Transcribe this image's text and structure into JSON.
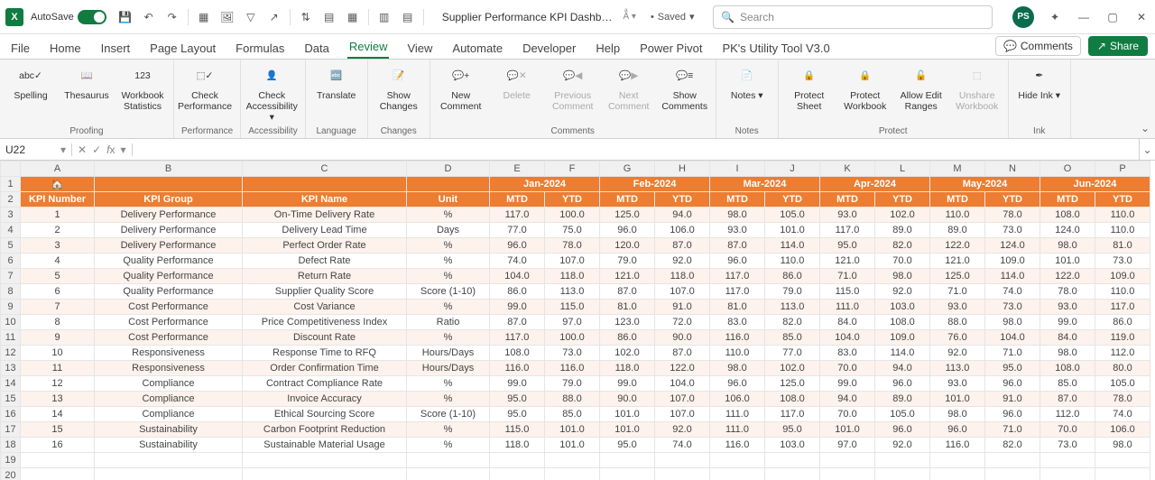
{
  "titlebar": {
    "autosave_label": "AutoSave",
    "doc_title": "Supplier Performance KPI Dashb…",
    "saved_label": "Saved",
    "search_placeholder": "Search",
    "avatar_initials": "PS"
  },
  "tabs": [
    "File",
    "Home",
    "Insert",
    "Page Layout",
    "Formulas",
    "Data",
    "Review",
    "View",
    "Automate",
    "Developer",
    "Help",
    "Power Pivot",
    "PK's Utility Tool V3.0"
  ],
  "active_tab": "Review",
  "tabs_right": {
    "comments": "Comments",
    "share": "Share"
  },
  "ribbon": {
    "groups": [
      {
        "label": "Proofing",
        "buttons": [
          {
            "name": "spelling",
            "label": "Spelling"
          },
          {
            "name": "thesaurus",
            "label": "Thesaurus"
          },
          {
            "name": "workbook-statistics",
            "label": "Workbook Statistics"
          }
        ]
      },
      {
        "label": "Performance",
        "buttons": [
          {
            "name": "check-performance",
            "label": "Check Performance"
          }
        ]
      },
      {
        "label": "Accessibility",
        "buttons": [
          {
            "name": "check-accessibility",
            "label": "Check Accessibility ▾"
          }
        ]
      },
      {
        "label": "Language",
        "buttons": [
          {
            "name": "translate",
            "label": "Translate"
          }
        ]
      },
      {
        "label": "Changes",
        "buttons": [
          {
            "name": "show-changes",
            "label": "Show Changes"
          }
        ]
      },
      {
        "label": "Comments",
        "buttons": [
          {
            "name": "new-comment",
            "label": "New Comment"
          },
          {
            "name": "delete-comment",
            "label": "Delete",
            "disabled": true
          },
          {
            "name": "previous-comment",
            "label": "Previous Comment",
            "disabled": true
          },
          {
            "name": "next-comment",
            "label": "Next Comment",
            "disabled": true
          },
          {
            "name": "show-comments",
            "label": "Show Comments"
          }
        ]
      },
      {
        "label": "Notes",
        "buttons": [
          {
            "name": "notes",
            "label": "Notes ▾"
          }
        ]
      },
      {
        "label": "Protect",
        "buttons": [
          {
            "name": "protect-sheet",
            "label": "Protect Sheet"
          },
          {
            "name": "protect-workbook",
            "label": "Protect Workbook"
          },
          {
            "name": "allow-edit-ranges",
            "label": "Allow Edit Ranges"
          },
          {
            "name": "unshare-workbook",
            "label": "Unshare Workbook",
            "disabled": true
          }
        ]
      },
      {
        "label": "Ink",
        "buttons": [
          {
            "name": "hide-ink",
            "label": "Hide Ink ▾"
          }
        ]
      }
    ]
  },
  "formula_bar": {
    "namebox": "U22",
    "formula": ""
  },
  "sheet": {
    "columns": [
      "A",
      "B",
      "C",
      "D",
      "E",
      "F",
      "G",
      "H",
      "I",
      "J",
      "K",
      "L",
      "M",
      "N",
      "O",
      "P"
    ],
    "months": [
      "Jan-2024",
      "Feb-2024",
      "Mar-2024",
      "Apr-2024",
      "May-2024",
      "Jun-2024"
    ],
    "subheaders": [
      "MTD",
      "YTD"
    ],
    "headers": [
      "KPI Number",
      "KPI Group",
      "KPI Name",
      "Unit"
    ],
    "rows": [
      {
        "n": "1",
        "group": "Delivery Performance",
        "name": "On-Time Delivery Rate",
        "unit": "%",
        "v": [
          "117.0",
          "100.0",
          "125.0",
          "94.0",
          "98.0",
          "105.0",
          "93.0",
          "102.0",
          "110.0",
          "78.0",
          "108.0",
          "110.0"
        ]
      },
      {
        "n": "2",
        "group": "Delivery Performance",
        "name": "Delivery Lead Time",
        "unit": "Days",
        "v": [
          "77.0",
          "75.0",
          "96.0",
          "106.0",
          "93.0",
          "101.0",
          "117.0",
          "89.0",
          "89.0",
          "73.0",
          "124.0",
          "110.0"
        ]
      },
      {
        "n": "3",
        "group": "Delivery Performance",
        "name": "Perfect Order Rate",
        "unit": "%",
        "v": [
          "96.0",
          "78.0",
          "120.0",
          "87.0",
          "87.0",
          "114.0",
          "95.0",
          "82.0",
          "122.0",
          "124.0",
          "98.0",
          "81.0"
        ]
      },
      {
        "n": "4",
        "group": "Quality Performance",
        "name": "Defect Rate",
        "unit": "%",
        "v": [
          "74.0",
          "107.0",
          "79.0",
          "92.0",
          "96.0",
          "110.0",
          "121.0",
          "70.0",
          "121.0",
          "109.0",
          "101.0",
          "73.0"
        ]
      },
      {
        "n": "5",
        "group": "Quality Performance",
        "name": "Return Rate",
        "unit": "%",
        "v": [
          "104.0",
          "118.0",
          "121.0",
          "118.0",
          "117.0",
          "86.0",
          "71.0",
          "98.0",
          "125.0",
          "114.0",
          "122.0",
          "109.0"
        ]
      },
      {
        "n": "6",
        "group": "Quality Performance",
        "name": "Supplier Quality Score",
        "unit": "Score (1-10)",
        "v": [
          "86.0",
          "113.0",
          "87.0",
          "107.0",
          "117.0",
          "79.0",
          "115.0",
          "92.0",
          "71.0",
          "74.0",
          "78.0",
          "110.0"
        ]
      },
      {
        "n": "7",
        "group": "Cost Performance",
        "name": "Cost Variance",
        "unit": "%",
        "v": [
          "99.0",
          "115.0",
          "81.0",
          "91.0",
          "81.0",
          "113.0",
          "111.0",
          "103.0",
          "93.0",
          "73.0",
          "93.0",
          "117.0"
        ]
      },
      {
        "n": "8",
        "group": "Cost Performance",
        "name": "Price Competitiveness Index",
        "unit": "Ratio",
        "v": [
          "87.0",
          "97.0",
          "123.0",
          "72.0",
          "83.0",
          "82.0",
          "84.0",
          "108.0",
          "88.0",
          "98.0",
          "99.0",
          "86.0"
        ]
      },
      {
        "n": "9",
        "group": "Cost Performance",
        "name": "Discount Rate",
        "unit": "%",
        "v": [
          "117.0",
          "100.0",
          "86.0",
          "90.0",
          "116.0",
          "85.0",
          "104.0",
          "109.0",
          "76.0",
          "104.0",
          "84.0",
          "119.0"
        ]
      },
      {
        "n": "10",
        "group": "Responsiveness",
        "name": "Response Time to RFQ",
        "unit": "Hours/Days",
        "v": [
          "108.0",
          "73.0",
          "102.0",
          "87.0",
          "110.0",
          "77.0",
          "83.0",
          "114.0",
          "92.0",
          "71.0",
          "98.0",
          "112.0"
        ]
      },
      {
        "n": "11",
        "group": "Responsiveness",
        "name": "Order Confirmation Time",
        "unit": "Hours/Days",
        "v": [
          "116.0",
          "116.0",
          "118.0",
          "122.0",
          "98.0",
          "102.0",
          "70.0",
          "94.0",
          "113.0",
          "95.0",
          "108.0",
          "80.0"
        ]
      },
      {
        "n": "12",
        "group": "Compliance",
        "name": "Contract Compliance Rate",
        "unit": "%",
        "v": [
          "99.0",
          "79.0",
          "99.0",
          "104.0",
          "96.0",
          "125.0",
          "99.0",
          "96.0",
          "93.0",
          "96.0",
          "85.0",
          "105.0"
        ]
      },
      {
        "n": "13",
        "group": "Compliance",
        "name": "Invoice Accuracy",
        "unit": "%",
        "v": [
          "95.0",
          "88.0",
          "90.0",
          "107.0",
          "106.0",
          "108.0",
          "94.0",
          "89.0",
          "101.0",
          "91.0",
          "87.0",
          "78.0"
        ]
      },
      {
        "n": "14",
        "group": "Compliance",
        "name": "Ethical Sourcing Score",
        "unit": "Score (1-10)",
        "v": [
          "95.0",
          "85.0",
          "101.0",
          "107.0",
          "111.0",
          "117.0",
          "70.0",
          "105.0",
          "98.0",
          "96.0",
          "112.0",
          "74.0"
        ]
      },
      {
        "n": "15",
        "group": "Sustainability",
        "name": "Carbon Footprint Reduction",
        "unit": "%",
        "v": [
          "115.0",
          "101.0",
          "101.0",
          "92.0",
          "111.0",
          "95.0",
          "101.0",
          "96.0",
          "96.0",
          "71.0",
          "70.0",
          "106.0"
        ]
      },
      {
        "n": "16",
        "group": "Sustainability",
        "name": "Sustainable Material Usage",
        "unit": "%",
        "v": [
          "118.0",
          "101.0",
          "95.0",
          "74.0",
          "116.0",
          "103.0",
          "97.0",
          "92.0",
          "116.0",
          "82.0",
          "73.0",
          "98.0"
        ]
      }
    ]
  }
}
